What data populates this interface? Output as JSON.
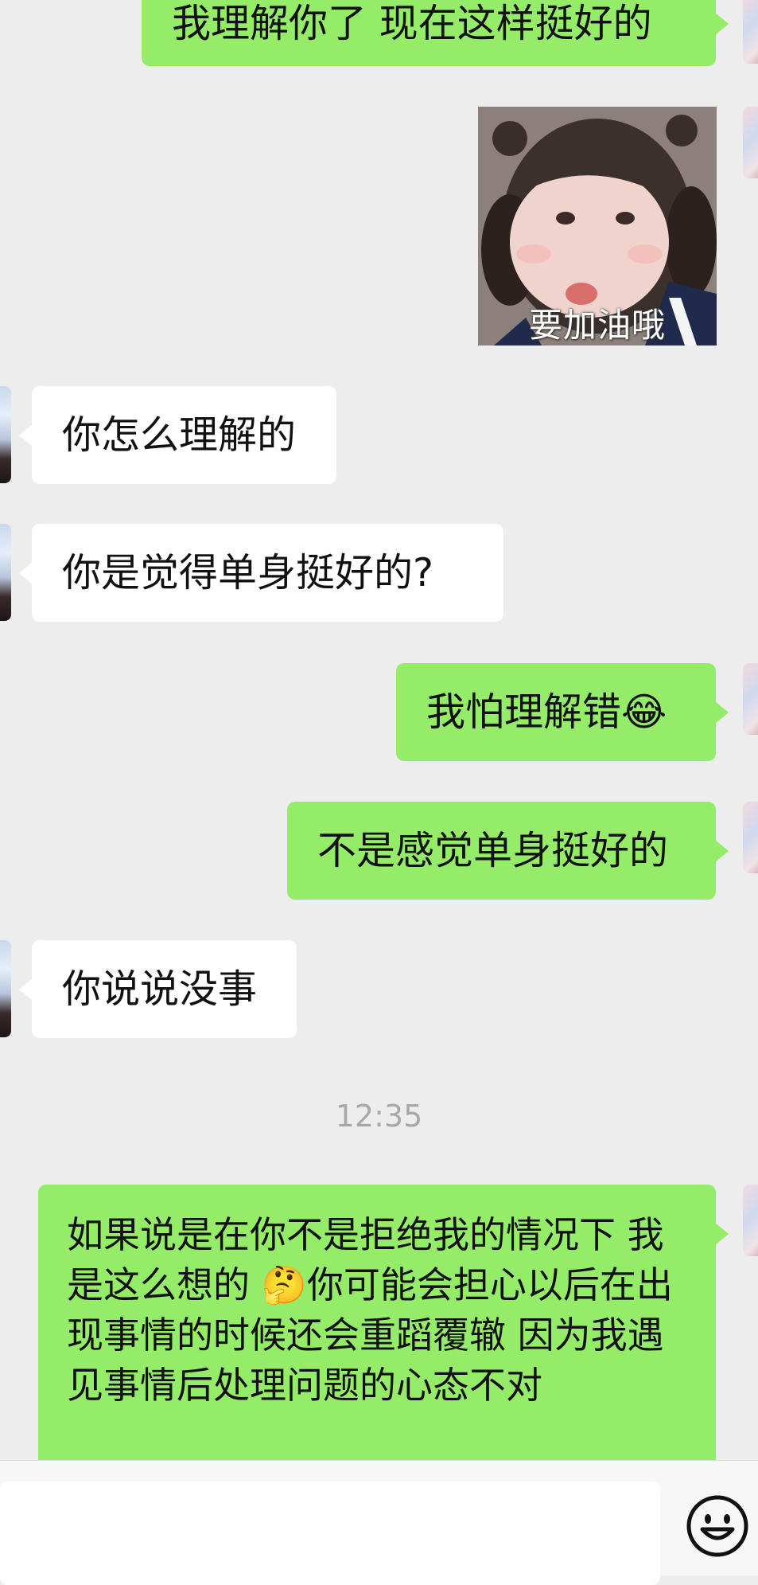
{
  "messages": [
    {
      "side": "out",
      "type": "text",
      "text": "我理解你了 现在这样挺好的"
    },
    {
      "side": "out",
      "type": "sticker",
      "caption": "要加油哦"
    },
    {
      "side": "in",
      "type": "text",
      "text": "你怎么理解的"
    },
    {
      "side": "in",
      "type": "text",
      "text": "你是觉得单身挺好的?"
    },
    {
      "side": "out",
      "type": "text",
      "text": "我怕理解错😂"
    },
    {
      "side": "out",
      "type": "text",
      "text": "不是感觉单身挺好的"
    },
    {
      "side": "in",
      "type": "text",
      "text": "你说说没事"
    },
    {
      "side": "out",
      "type": "text",
      "text": "如果说是在你不是拒绝我的情况下 我是这么想的 🤔你可能会担心以后在出现事情的时候还会重蹈覆辙 因为我遇见事情后处理问题的心态不对"
    }
  ],
  "timestamp": "12:35",
  "input": {
    "placeholder": "",
    "emoji_icon": "smiley-face-icon"
  },
  "colors": {
    "background": "#ededed",
    "outgoing_bubble": "#95ec69",
    "incoming_bubble": "#ffffff",
    "timestamp_text": "#a8a8a8"
  }
}
